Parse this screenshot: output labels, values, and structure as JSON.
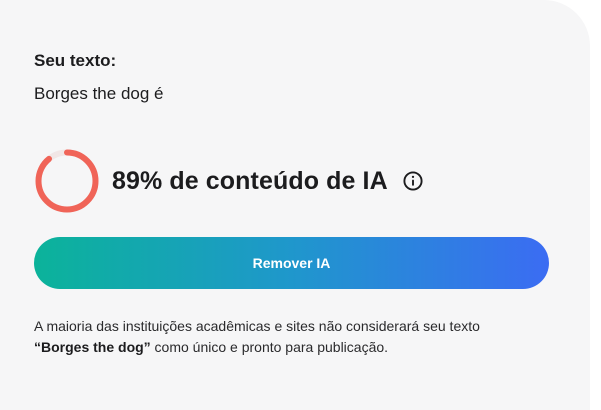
{
  "input": {
    "label": "Seu texto:",
    "value": "Borges the dog é"
  },
  "result": {
    "percent": 89,
    "score_text": "89% de conteúdo de IA",
    "gauge_color": "#f06458",
    "gauge_track_color": "#f1e6e6",
    "info_icon": "info-circle-icon"
  },
  "action": {
    "remove_label": "Remover IA"
  },
  "disclaimer": {
    "part1": "A maioria das instituições acadêmicas e sites não considerará seu texto",
    "quoted": "“Borges the dog”",
    "part2": " como único e pronto para publicação."
  }
}
